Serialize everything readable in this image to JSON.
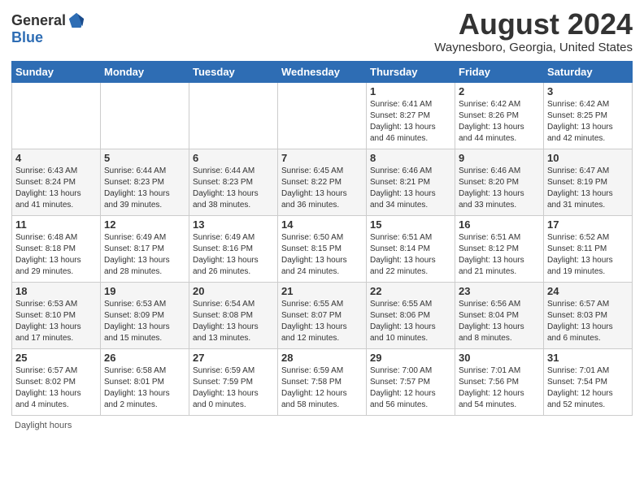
{
  "logo": {
    "general": "General",
    "blue": "Blue"
  },
  "title": "August 2024",
  "subtitle": "Waynesboro, Georgia, United States",
  "weekdays": [
    "Sunday",
    "Monday",
    "Tuesday",
    "Wednesday",
    "Thursday",
    "Friday",
    "Saturday"
  ],
  "weeks": [
    [
      {
        "day": "",
        "detail": ""
      },
      {
        "day": "",
        "detail": ""
      },
      {
        "day": "",
        "detail": ""
      },
      {
        "day": "",
        "detail": ""
      },
      {
        "day": "1",
        "detail": "Sunrise: 6:41 AM\nSunset: 8:27 PM\nDaylight: 13 hours\nand 46 minutes."
      },
      {
        "day": "2",
        "detail": "Sunrise: 6:42 AM\nSunset: 8:26 PM\nDaylight: 13 hours\nand 44 minutes."
      },
      {
        "day": "3",
        "detail": "Sunrise: 6:42 AM\nSunset: 8:25 PM\nDaylight: 13 hours\nand 42 minutes."
      }
    ],
    [
      {
        "day": "4",
        "detail": "Sunrise: 6:43 AM\nSunset: 8:24 PM\nDaylight: 13 hours\nand 41 minutes."
      },
      {
        "day": "5",
        "detail": "Sunrise: 6:44 AM\nSunset: 8:23 PM\nDaylight: 13 hours\nand 39 minutes."
      },
      {
        "day": "6",
        "detail": "Sunrise: 6:44 AM\nSunset: 8:23 PM\nDaylight: 13 hours\nand 38 minutes."
      },
      {
        "day": "7",
        "detail": "Sunrise: 6:45 AM\nSunset: 8:22 PM\nDaylight: 13 hours\nand 36 minutes."
      },
      {
        "day": "8",
        "detail": "Sunrise: 6:46 AM\nSunset: 8:21 PM\nDaylight: 13 hours\nand 34 minutes."
      },
      {
        "day": "9",
        "detail": "Sunrise: 6:46 AM\nSunset: 8:20 PM\nDaylight: 13 hours\nand 33 minutes."
      },
      {
        "day": "10",
        "detail": "Sunrise: 6:47 AM\nSunset: 8:19 PM\nDaylight: 13 hours\nand 31 minutes."
      }
    ],
    [
      {
        "day": "11",
        "detail": "Sunrise: 6:48 AM\nSunset: 8:18 PM\nDaylight: 13 hours\nand 29 minutes."
      },
      {
        "day": "12",
        "detail": "Sunrise: 6:49 AM\nSunset: 8:17 PM\nDaylight: 13 hours\nand 28 minutes."
      },
      {
        "day": "13",
        "detail": "Sunrise: 6:49 AM\nSunset: 8:16 PM\nDaylight: 13 hours\nand 26 minutes."
      },
      {
        "day": "14",
        "detail": "Sunrise: 6:50 AM\nSunset: 8:15 PM\nDaylight: 13 hours\nand 24 minutes."
      },
      {
        "day": "15",
        "detail": "Sunrise: 6:51 AM\nSunset: 8:14 PM\nDaylight: 13 hours\nand 22 minutes."
      },
      {
        "day": "16",
        "detail": "Sunrise: 6:51 AM\nSunset: 8:12 PM\nDaylight: 13 hours\nand 21 minutes."
      },
      {
        "day": "17",
        "detail": "Sunrise: 6:52 AM\nSunset: 8:11 PM\nDaylight: 13 hours\nand 19 minutes."
      }
    ],
    [
      {
        "day": "18",
        "detail": "Sunrise: 6:53 AM\nSunset: 8:10 PM\nDaylight: 13 hours\nand 17 minutes."
      },
      {
        "day": "19",
        "detail": "Sunrise: 6:53 AM\nSunset: 8:09 PM\nDaylight: 13 hours\nand 15 minutes."
      },
      {
        "day": "20",
        "detail": "Sunrise: 6:54 AM\nSunset: 8:08 PM\nDaylight: 13 hours\nand 13 minutes."
      },
      {
        "day": "21",
        "detail": "Sunrise: 6:55 AM\nSunset: 8:07 PM\nDaylight: 13 hours\nand 12 minutes."
      },
      {
        "day": "22",
        "detail": "Sunrise: 6:55 AM\nSunset: 8:06 PM\nDaylight: 13 hours\nand 10 minutes."
      },
      {
        "day": "23",
        "detail": "Sunrise: 6:56 AM\nSunset: 8:04 PM\nDaylight: 13 hours\nand 8 minutes."
      },
      {
        "day": "24",
        "detail": "Sunrise: 6:57 AM\nSunset: 8:03 PM\nDaylight: 13 hours\nand 6 minutes."
      }
    ],
    [
      {
        "day": "25",
        "detail": "Sunrise: 6:57 AM\nSunset: 8:02 PM\nDaylight: 13 hours\nand 4 minutes."
      },
      {
        "day": "26",
        "detail": "Sunrise: 6:58 AM\nSunset: 8:01 PM\nDaylight: 13 hours\nand 2 minutes."
      },
      {
        "day": "27",
        "detail": "Sunrise: 6:59 AM\nSunset: 7:59 PM\nDaylight: 13 hours\nand 0 minutes."
      },
      {
        "day": "28",
        "detail": "Sunrise: 6:59 AM\nSunset: 7:58 PM\nDaylight: 12 hours\nand 58 minutes."
      },
      {
        "day": "29",
        "detail": "Sunrise: 7:00 AM\nSunset: 7:57 PM\nDaylight: 12 hours\nand 56 minutes."
      },
      {
        "day": "30",
        "detail": "Sunrise: 7:01 AM\nSunset: 7:56 PM\nDaylight: 12 hours\nand 54 minutes."
      },
      {
        "day": "31",
        "detail": "Sunrise: 7:01 AM\nSunset: 7:54 PM\nDaylight: 12 hours\nand 52 minutes."
      }
    ]
  ],
  "footer": "Daylight hours"
}
